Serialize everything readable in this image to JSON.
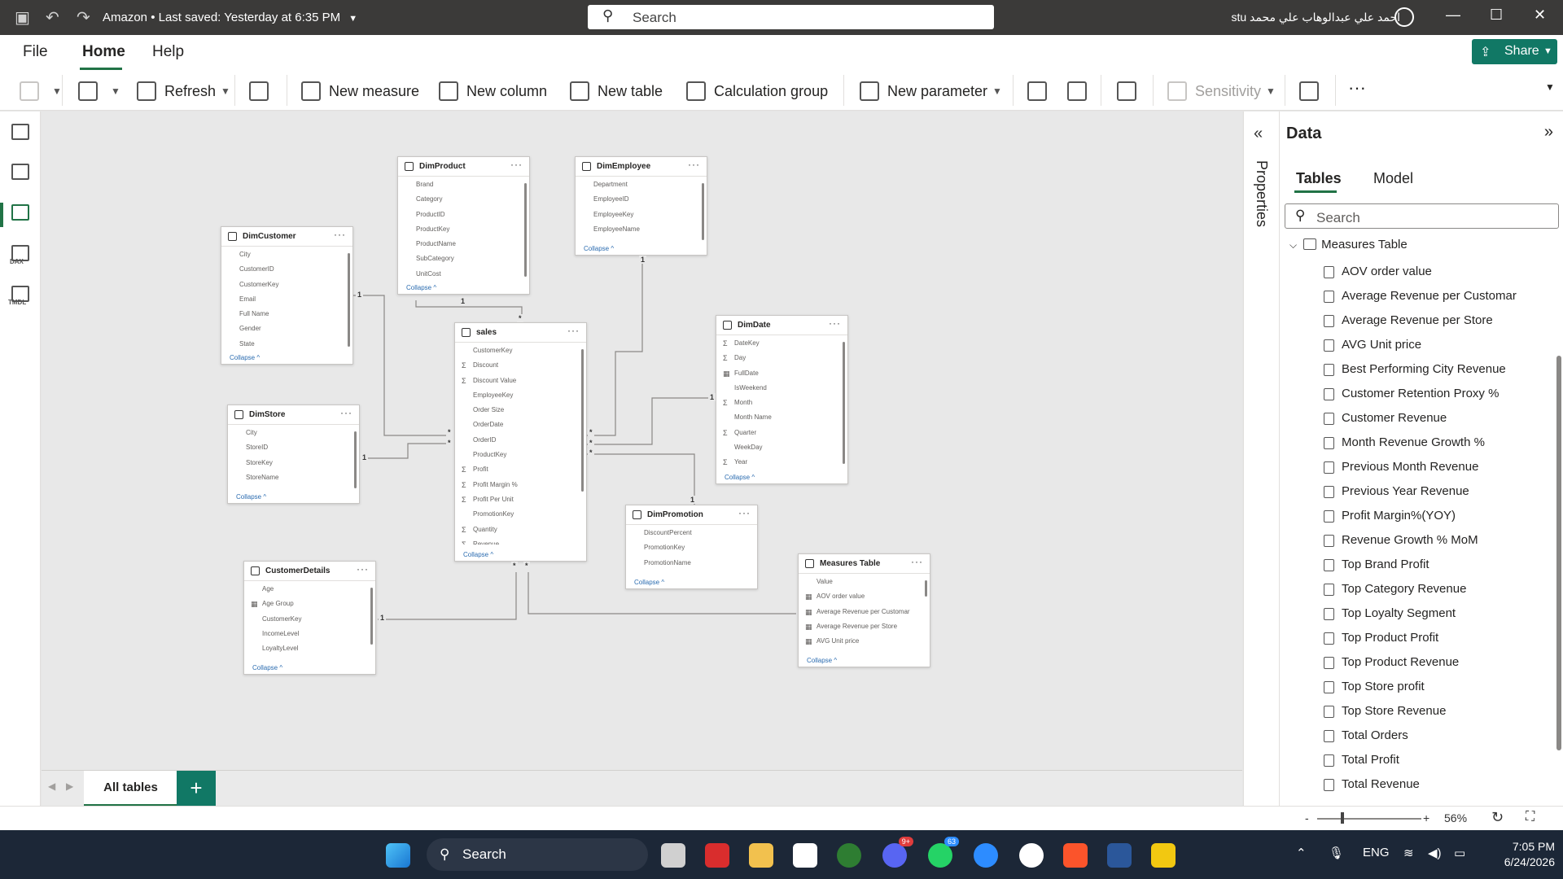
{
  "titlebar": {
    "file_title": "Amazon",
    "saved_status": "Last saved: Yesterday at 6:35 PM",
    "search_placeholder": "Search",
    "user_name": "stu احمد علي عبدالوهاب علي محمد"
  },
  "menu": {
    "file": "File",
    "home": "Home",
    "help": "Help",
    "share": "Share"
  },
  "ribbon": {
    "refresh": "Refresh",
    "new_measure": "New measure",
    "new_column": "New column",
    "new_table": "New table",
    "calculation_group": "Calculation group",
    "new_parameter": "New parameter",
    "sensitivity": "Sensitivity",
    "more": "···"
  },
  "rail": {
    "dax": "DAX",
    "tmdl": "TMDL"
  },
  "tables": [
    {
      "name": "DimProduct",
      "fields": [
        {
          "n": "Brand"
        },
        {
          "n": "Category"
        },
        {
          "n": "ProductID"
        },
        {
          "n": "ProductKey"
        },
        {
          "n": "ProductName"
        },
        {
          "n": "SubCategory"
        },
        {
          "n": "UnitCost"
        }
      ],
      "collapse": "Collapse ^"
    },
    {
      "name": "DimEmployee",
      "fields": [
        {
          "n": "Department"
        },
        {
          "n": "EmployeeID"
        },
        {
          "n": "EmployeeKey"
        },
        {
          "n": "EmployeeName"
        }
      ],
      "collapse": "Collapse ^"
    },
    {
      "name": "DimCustomer",
      "fields": [
        {
          "n": "City"
        },
        {
          "n": "CustomerID"
        },
        {
          "n": "CustomerKey"
        },
        {
          "n": "Email"
        },
        {
          "n": "Full Name"
        },
        {
          "n": "Gender"
        },
        {
          "n": "State"
        }
      ],
      "collapse": "Collapse ^"
    },
    {
      "name": "sales",
      "fields": [
        {
          "n": "CustomerKey"
        },
        {
          "n": "Discount",
          "s": "Σ"
        },
        {
          "n": "Discount Value",
          "s": "Σ"
        },
        {
          "n": "EmployeeKey"
        },
        {
          "n": "Order Size"
        },
        {
          "n": "OrderDate"
        },
        {
          "n": "OrderID"
        },
        {
          "n": "ProductKey"
        },
        {
          "n": "Profit",
          "s": "Σ"
        },
        {
          "n": "Profit Margin %",
          "s": "Σ"
        },
        {
          "n": "Profit Per Unit",
          "s": "Σ"
        },
        {
          "n": "PromotionKey"
        },
        {
          "n": "Quantity",
          "s": "Σ"
        },
        {
          "n": "Revenue",
          "s": "Σ"
        }
      ],
      "collapse": "Collapse ^"
    },
    {
      "name": "DimDate",
      "fields": [
        {
          "n": "DateKey",
          "s": "Σ"
        },
        {
          "n": "Day",
          "s": "Σ"
        },
        {
          "n": "FullDate",
          "s": "▦"
        },
        {
          "n": "IsWeekend"
        },
        {
          "n": "Month",
          "s": "Σ"
        },
        {
          "n": "Month Name"
        },
        {
          "n": "Quarter",
          "s": "Σ"
        },
        {
          "n": "WeekDay"
        },
        {
          "n": "Year",
          "s": "Σ"
        }
      ],
      "collapse": "Collapse ^"
    },
    {
      "name": "DimStore",
      "fields": [
        {
          "n": "City"
        },
        {
          "n": "StoreID"
        },
        {
          "n": "StoreKey"
        },
        {
          "n": "StoreName"
        }
      ],
      "collapse": "Collapse ^"
    },
    {
      "name": "DimPromotion",
      "fields": [
        {
          "n": "DiscountPercent"
        },
        {
          "n": "PromotionKey"
        },
        {
          "n": "PromotionName"
        }
      ],
      "collapse": "Collapse ^"
    },
    {
      "name": "CustomerDetails",
      "fields": [
        {
          "n": "Age"
        },
        {
          "n": "Age Group",
          "s": "▦"
        },
        {
          "n": "CustomerKey"
        },
        {
          "n": "IncomeLevel"
        },
        {
          "n": "LoyaltyLevel"
        }
      ],
      "collapse": "Collapse ^"
    },
    {
      "name": "Measures Table",
      "fields": [
        {
          "n": "Value"
        },
        {
          "n": "AOV order value",
          "s": "▦"
        },
        {
          "n": "Average Revenue per Customar",
          "s": "▦"
        },
        {
          "n": "Average Revenue per Store",
          "s": "▦"
        },
        {
          "n": "AVG Unit price",
          "s": "▦"
        }
      ],
      "collapse": "Collapse ^"
    }
  ],
  "cardinality": {
    "one": "1",
    "many": "*"
  },
  "tabbar": {
    "tab": "All tables",
    "add": "+"
  },
  "properties": {
    "label": "Properties"
  },
  "data_pane": {
    "title": "Data",
    "tab_tables": "Tables",
    "tab_model": "Model",
    "search_placeholder": "Search",
    "group": "Measures Table",
    "measures": [
      "AOV order value",
      "Average Revenue per Customar",
      "Average Revenue per Store",
      "AVG Unit price",
      "Best Performing City Revenue",
      "Customer Retention Proxy %",
      "Customer Revenue",
      "Month Revenue Growth %",
      "Previous Month Revenue",
      "Previous Year Revenue",
      "Profit Margin%(YOY)",
      "Revenue Growth % MoM",
      "Top Brand Profit",
      "Top Category Revenue",
      "Top Loyalty Segment",
      "Top Product Profit",
      "Top Product Revenue",
      "Top Store profit",
      "Top Store Revenue",
      "Total Orders",
      "Total Profit",
      "Total Revenue"
    ]
  },
  "status": {
    "zoom": "56%",
    "minus": "-",
    "plus": "+"
  },
  "taskbar": {
    "search": "Search",
    "discord_badge": "9+",
    "whatsapp_badge": "63",
    "lang": "ENG",
    "time": "7:05 PM",
    "date": "6/24/2026"
  }
}
